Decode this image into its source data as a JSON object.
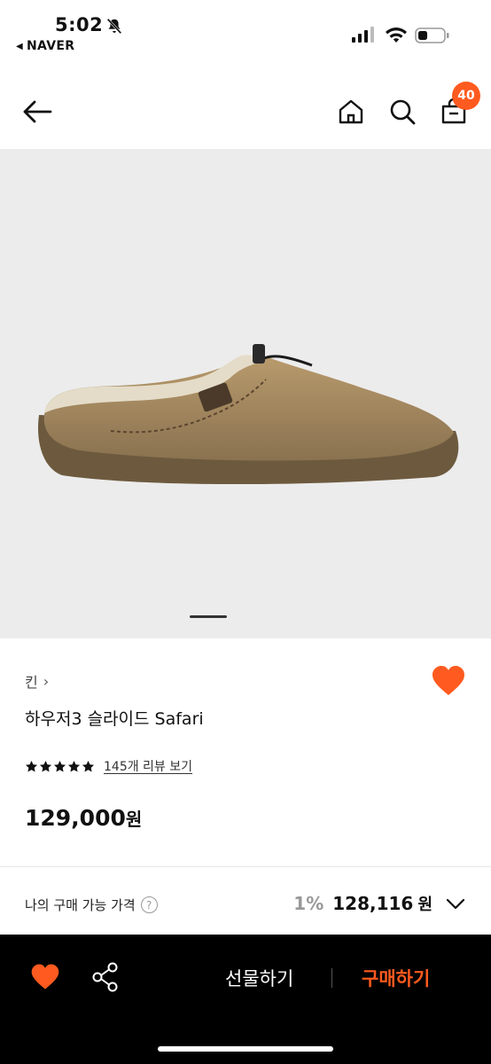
{
  "status_bar": {
    "time": "5:02",
    "back_app": "NAVER",
    "icons": [
      "bell-slash-icon",
      "signal-icon",
      "wifi-icon",
      "battery-icon"
    ]
  },
  "header": {
    "icons": [
      "back-arrow-icon",
      "home-icon",
      "search-icon",
      "cart-icon"
    ],
    "cart_count": "40"
  },
  "product": {
    "brand": "킨",
    "brand_chevron": "›",
    "title": "하우저3 슬라이드 Safari",
    "rating_stars": 5,
    "review_link": "145개 리뷰 보기",
    "price": "129,000",
    "price_unit": "원",
    "liked": true
  },
  "my_price": {
    "label": "나의 구매 가능 가격",
    "help_symbol": "?",
    "discount": "1%",
    "amount": "128,116",
    "unit": "원"
  },
  "bottom_bar": {
    "gift_label": "선물하기",
    "buy_label": "구매하기"
  },
  "colors": {
    "accent": "#ff5a1f",
    "bottom_bar_bg": "#000000",
    "image_bg": "#ececec"
  }
}
